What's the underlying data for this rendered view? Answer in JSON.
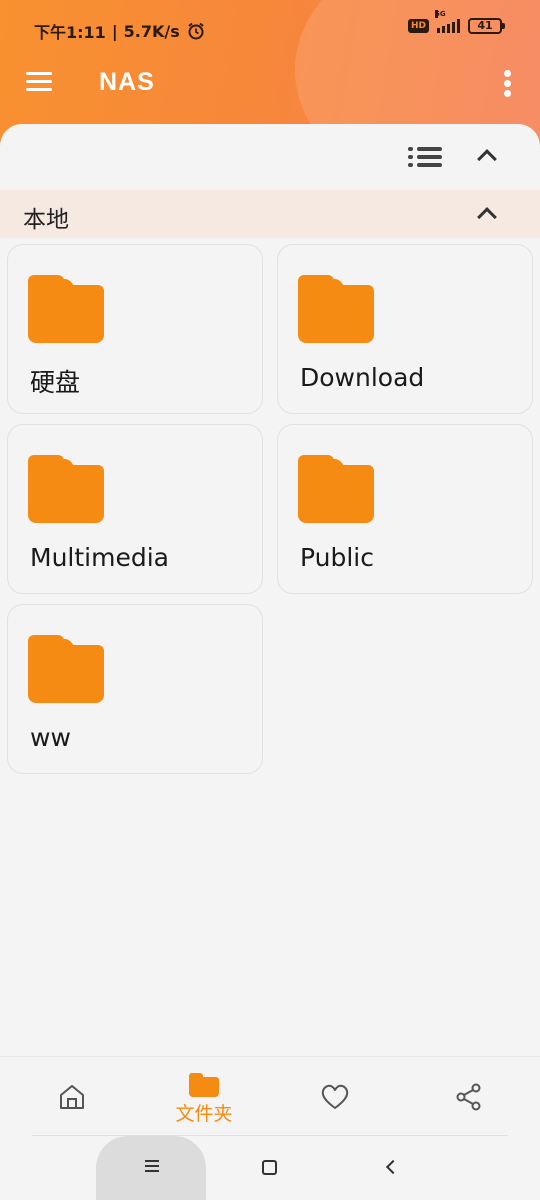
{
  "status_bar": {
    "time": "下午1:11",
    "separator": "|",
    "net_speed": "5.7K/s",
    "hd_badge": "HD",
    "network_type": "5G",
    "battery": "41"
  },
  "app_bar": {
    "title": "NAS"
  },
  "section": {
    "title": "本地"
  },
  "folders": [
    {
      "name": "硬盘"
    },
    {
      "name": "Download"
    },
    {
      "name": "Multimedia"
    },
    {
      "name": "Public"
    },
    {
      "name": "ww"
    }
  ],
  "bottom_nav": {
    "items": [
      {
        "icon": "home-icon",
        "label": ""
      },
      {
        "icon": "folder-icon",
        "label": "文件夹",
        "active": true
      },
      {
        "icon": "heart-icon",
        "label": ""
      },
      {
        "icon": "share-icon",
        "label": ""
      }
    ]
  },
  "colors": {
    "accent": "#f58b12",
    "header_start": "#f89130",
    "header_end": "#f67c4e",
    "section_bg": "#f6e9e2"
  }
}
